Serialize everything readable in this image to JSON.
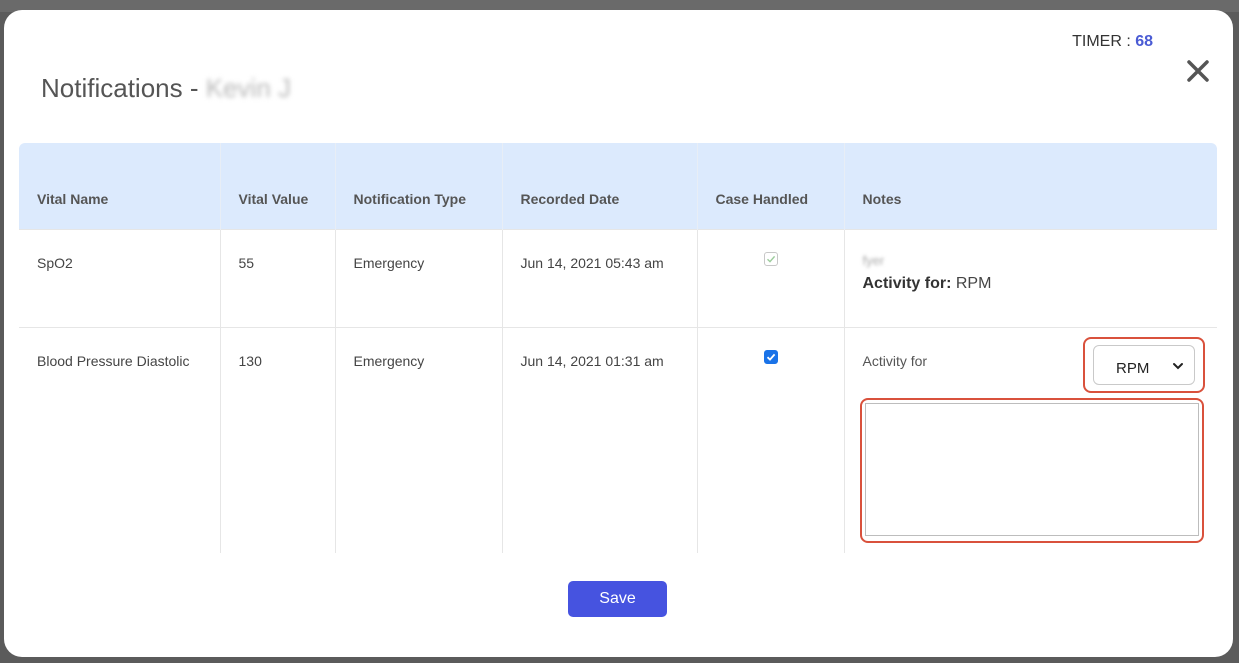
{
  "modal": {
    "title_prefix": "Notifications - ",
    "patient_name": "Kevin J",
    "timer_label": "TIMER : ",
    "timer_value": "68",
    "save_label": "Save"
  },
  "table": {
    "headers": {
      "vital_name": "Vital Name",
      "vital_value": "Vital Value",
      "notification_type": "Notification Type",
      "recorded_date": "Recorded Date",
      "case_handled": "Case Handled",
      "notes": "Notes"
    },
    "rows": [
      {
        "vital_name": "SpO2",
        "vital_value": "55",
        "notification_type": "Emergency",
        "recorded_date": "Jun 14, 2021 05:43 am",
        "case_handled": true,
        "case_handled_disabled": true,
        "note_text": "fyer",
        "activity_label": "Activity for:",
        "activity_value": "RPM"
      },
      {
        "vital_name": "Blood Pressure Diastolic",
        "vital_value": "130",
        "notification_type": "Emergency",
        "recorded_date": "Jun 14, 2021 01:31 am",
        "case_handled": true,
        "case_handled_disabled": false,
        "activity_label": "Activity for",
        "activity_select_value": "RPM",
        "note_input_value": ""
      }
    ]
  },
  "colors": {
    "accent": "#4653e0",
    "header_bg": "#dceafd",
    "highlight": "#d9513c",
    "checkbox": "#1a73e8"
  },
  "icons": {
    "close": "close-icon",
    "chevron": "chevron-down-icon",
    "check": "check-icon"
  }
}
